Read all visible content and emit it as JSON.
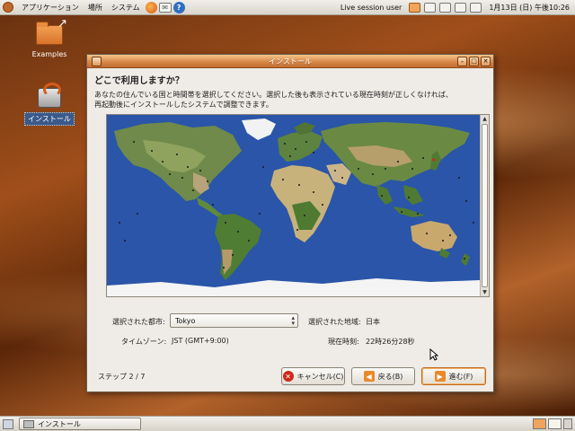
{
  "top_panel": {
    "menus": [
      "アプリケーション",
      "場所",
      "システム"
    ],
    "user": "Live session user",
    "clock": "1月13日 (日) 午後10:26"
  },
  "desktop": {
    "icons": [
      {
        "label": "Examples"
      },
      {
        "label": "インストール"
      }
    ]
  },
  "dialog": {
    "title": "インストール",
    "heading": "どこで利用しますか？",
    "description_line1": "あなたの住んでいる国と時間帯を選択してください。選択した後も表示されている現在時刻が正しくなければ、",
    "description_line2": "再起動後にインストールしたシステムで調整できます。",
    "selected_city_label": "選択された都市:",
    "selected_city_value": "Tokyo",
    "selected_region_label": "選択された地域:",
    "selected_region_value": "日本",
    "timezone_label": "タイムゾーン:",
    "timezone_value": "JST (GMT+9:00)",
    "current_time_label": "現在時刻:",
    "current_time_value": "22時26分28秒",
    "step": "ステップ 2 / 7",
    "buttons": {
      "cancel": "キャンセル(C)",
      "back": "戻る(B)",
      "forward": "進む(F)"
    }
  },
  "taskbar": {
    "task": "インストール"
  },
  "colors": {
    "accent": "#d8894a",
    "ocean": "#2a55a8",
    "panel": "#e6e2da"
  }
}
